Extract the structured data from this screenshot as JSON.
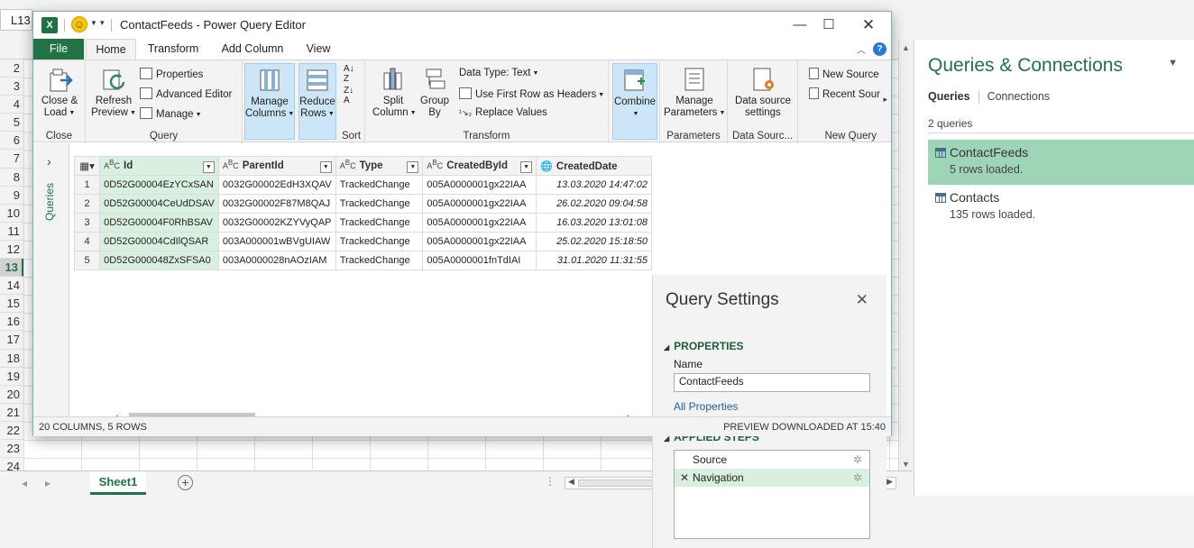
{
  "excel": {
    "namebox": "L13",
    "rows": [
      "2",
      "3",
      "4",
      "5",
      "6",
      "7",
      "8",
      "9",
      "10",
      "11",
      "12",
      "13",
      "14",
      "15",
      "16",
      "17",
      "18",
      "19",
      "20",
      "21",
      "22",
      "23",
      "24"
    ],
    "selected_row": "13",
    "sheet_tab": "Sheet1"
  },
  "queries_pane": {
    "title": "Queries & Connections",
    "tab_queries": "Queries",
    "tab_connections": "Connections",
    "count": "2 queries",
    "items": [
      {
        "name": "ContactFeeds",
        "info": "5 rows loaded."
      },
      {
        "name": "Contacts",
        "info": "135 rows loaded."
      }
    ]
  },
  "pq": {
    "title": "ContactFeeds - Power Query Editor",
    "tabs": [
      "File",
      "Home",
      "Transform",
      "Add Column",
      "View"
    ],
    "ribbon": {
      "close_load": "Close &\nLoad",
      "close_group": "Close",
      "refresh_preview": "Refresh\nPreview",
      "properties": "Properties",
      "advanced_editor": "Advanced Editor",
      "manage": "Manage",
      "query_group": "Query",
      "manage_columns": "Manage\nColumns",
      "reduce_rows": "Reduce\nRows",
      "sort_group": "Sort",
      "split_column": "Split\nColumn",
      "group_by": "Group\nBy",
      "data_type": "Data Type: Text",
      "use_first_row": "Use First Row as Headers",
      "replace_values": "Replace Values",
      "transform_group": "Transform",
      "combine": "Combine",
      "manage_parameters": "Manage\nParameters",
      "parameters_group": "Parameters",
      "data_source_settings": "Data source\nsettings",
      "data_source_group": "Data Sourc...",
      "new_source": "New Source",
      "recent_sources": "Recent Sour",
      "new_query_group": "New Query"
    },
    "queries_label": "Queries",
    "grid": {
      "columns": [
        "Id",
        "ParentId",
        "Type",
        "CreatedById",
        "CreatedDate"
      ],
      "rows": [
        [
          "1",
          "0D52G00004EzYCxSAN",
          "0032G00002EdH3XQAV",
          "TrackedChange",
          "005A0000001gx22IAA",
          "13.03.2020 14:47:02"
        ],
        [
          "2",
          "0D52G00004CeUdDSAV",
          "0032G00002F87M8QAJ",
          "TrackedChange",
          "005A0000001gx22IAA",
          "26.02.2020 09:04:58"
        ],
        [
          "3",
          "0D52G00004F0RhBSAV",
          "0032G00002KZYVyQAP",
          "TrackedChange",
          "005A0000001gx22IAA",
          "16.03.2020 13:01:08"
        ],
        [
          "4",
          "0D52G00004CdIlQSAR",
          "003A000001wBVgUIAW",
          "TrackedChange",
          "005A0000001gx22IAA",
          "25.02.2020 15:18:50"
        ],
        [
          "5",
          "0D52G000048ZxSFSA0",
          "003A0000028nAOzIAM",
          "TrackedChange",
          "005A0000001fnTdIAI",
          "31.01.2020 11:31:55"
        ]
      ]
    },
    "settings": {
      "title": "Query Settings",
      "properties_header": "PROPERTIES",
      "name_label": "Name",
      "name_value": "ContactFeeds",
      "all_properties": "All Properties",
      "applied_steps_header": "APPLIED STEPS",
      "steps": [
        "Source",
        "Navigation"
      ]
    },
    "status_left": "20 COLUMNS, 5 ROWS",
    "status_right": "PREVIEW DOWNLOADED AT 15:40"
  },
  "colors": {
    "excel_green": "#217346",
    "selection_green": "#d9efe0",
    "pane_selection": "#9fd5b7"
  }
}
